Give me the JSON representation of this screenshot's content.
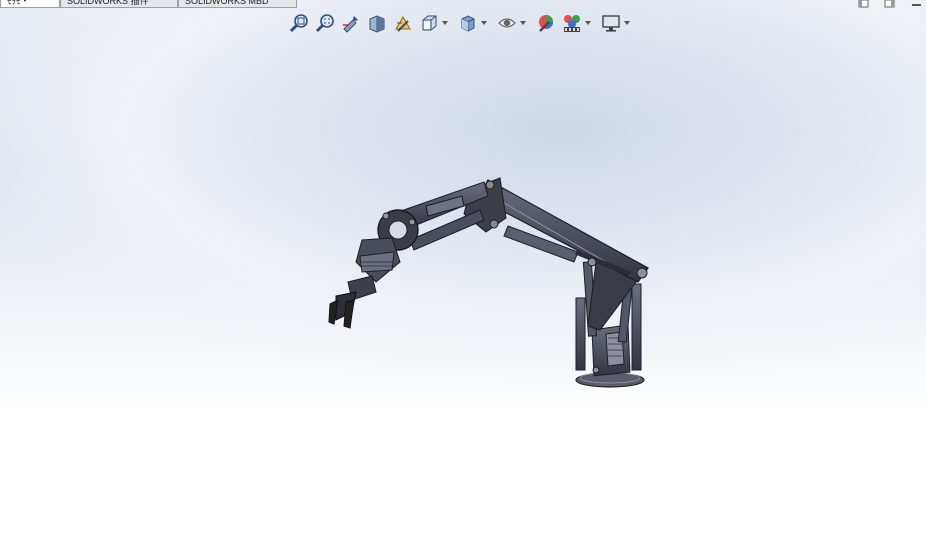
{
  "tabs": [
    {
      "label": "ﾓｦﾓ・",
      "active": true
    },
    {
      "label": "SOLIDWORKS 插件",
      "active": false
    },
    {
      "label": "SOLIDWORKS MBD",
      "active": false
    }
  ],
  "heads_up_toolbar": [
    {
      "icon": "zoom-to-fit-icon"
    },
    {
      "icon": "zoom-to-area-icon"
    },
    {
      "icon": "previous-view-icon"
    },
    {
      "icon": "section-view-icon"
    },
    {
      "icon": "dynamic-annotation-views-icon"
    },
    {
      "icon": "view-orientation-icon",
      "dropdown": true
    },
    {
      "icon": "display-style-icon",
      "dropdown": true
    },
    {
      "icon": "hide-show-items-icon",
      "dropdown": true
    },
    {
      "icon": "edit-appearance-icon"
    },
    {
      "icon": "apply-scene-icon",
      "dropdown": true
    },
    {
      "icon": "view-settings-icon",
      "dropdown": true
    }
  ],
  "window_controls": [
    "tile-left-icon",
    "tile-right-icon",
    "minimize-icon"
  ],
  "colors": {
    "model": "#4a4d5c",
    "model_dark": "#2a2c36",
    "viewport_top": "#dfe5ef",
    "viewport_bottom": "#ffffff"
  }
}
